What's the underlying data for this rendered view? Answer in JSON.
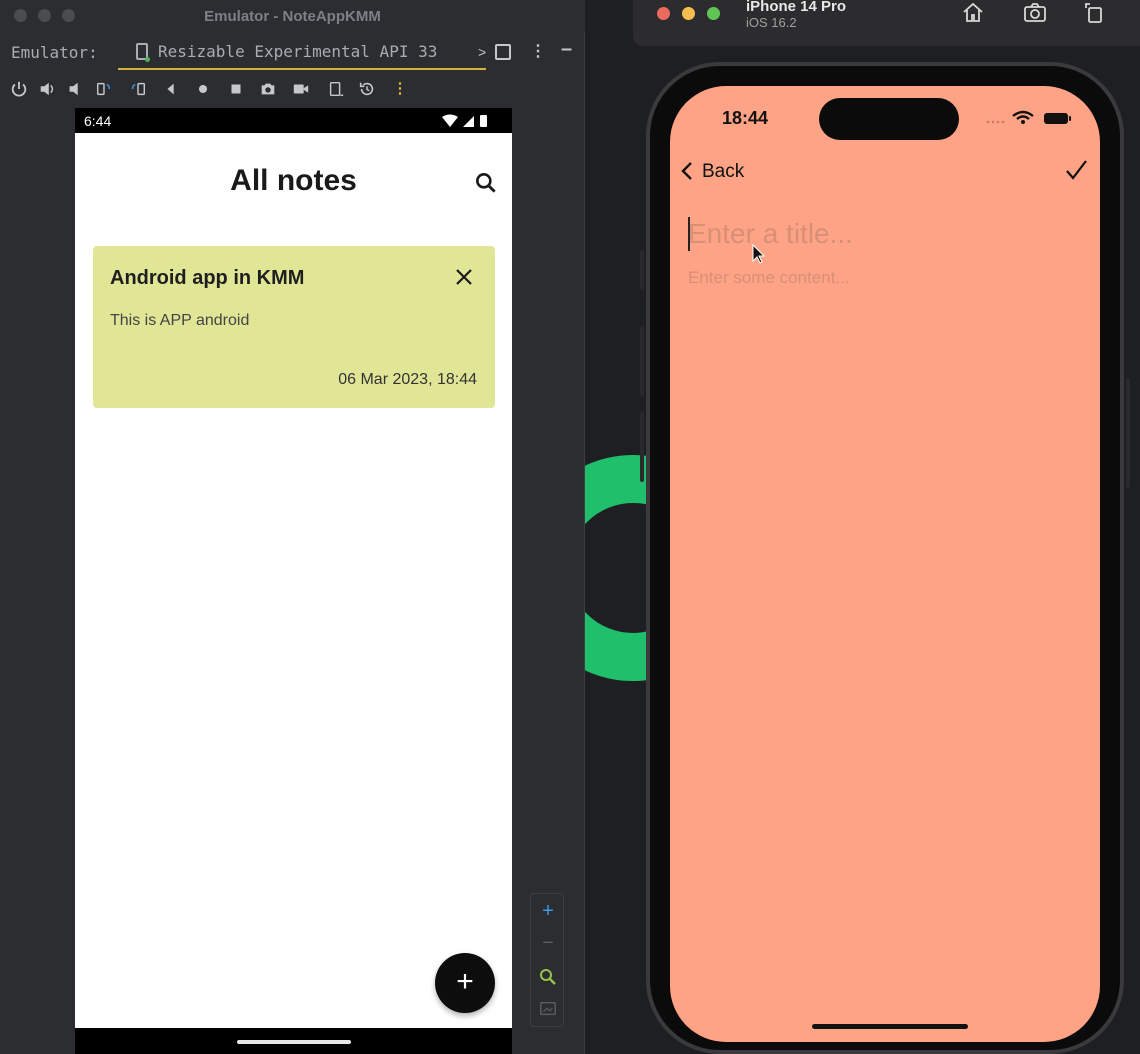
{
  "emulator": {
    "window_title": "Emulator - NoteAppKMM",
    "label": "Emulator:",
    "tab_title": "Resizable Experimental API 33",
    "tab_suffix": ">"
  },
  "android": {
    "status_time": "6:44",
    "screen_title": "All notes",
    "notes": [
      {
        "title": "Android app in KMM",
        "content": "This is APP android",
        "date": "06 Mar 2023, 18:44",
        "color": "#e1e696"
      }
    ],
    "fab_label": "+"
  },
  "zoom": {
    "zoom_in": "+",
    "zoom_out": "−"
  },
  "ios": {
    "device_name": "iPhone 14 Pro",
    "os_version": "iOS 16.2",
    "status_time": "18:44",
    "back_label": "Back",
    "title_placeholder": "Enter a title...",
    "content_placeholder": "Enter some content...",
    "screen_color": "#fea385"
  }
}
